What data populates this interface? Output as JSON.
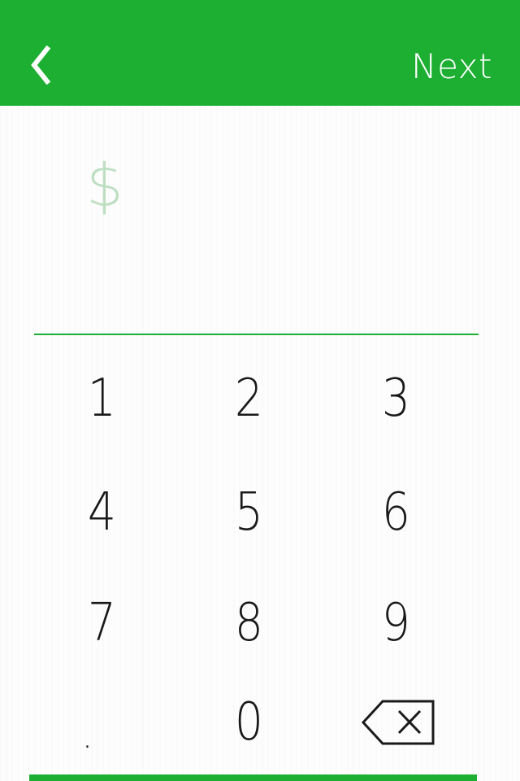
{
  "header": {
    "back_icon": "chevron-left-icon",
    "next_label": "Next"
  },
  "amount": {
    "currency_symbol": "$",
    "value": ""
  },
  "keypad": {
    "keys": [
      "1",
      "2",
      "3",
      "4",
      "5",
      "6",
      "7",
      "8",
      "9",
      ".",
      "0"
    ],
    "backspace_icon": "backspace-icon"
  },
  "colors": {
    "brand_green": "#1daf32",
    "currency_tint": "#bedfc2",
    "key_text": "#1a1a1a",
    "background": "#fdfdfd"
  }
}
